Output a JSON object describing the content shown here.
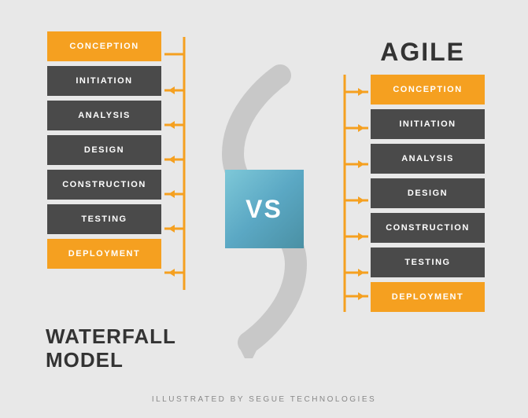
{
  "waterfall": {
    "title": "WATERFALL\nMODEL",
    "steps": [
      {
        "label": "CONCEPTION",
        "type": "orange"
      },
      {
        "label": "INITIATION",
        "type": "dark"
      },
      {
        "label": "ANALYSIS",
        "type": "dark"
      },
      {
        "label": "DESIGN",
        "type": "dark"
      },
      {
        "label": "CONSTRUCTION",
        "type": "dark"
      },
      {
        "label": "TESTING",
        "type": "dark"
      },
      {
        "label": "DEPLOYMENT",
        "type": "orange"
      }
    ]
  },
  "agile": {
    "title": "AGILE",
    "steps": [
      {
        "label": "CONCEPTION",
        "type": "orange"
      },
      {
        "label": "INITIATION",
        "type": "dark"
      },
      {
        "label": "ANALYSIS",
        "type": "dark"
      },
      {
        "label": "DESIGN",
        "type": "dark"
      },
      {
        "label": "CONSTRUCTION",
        "type": "dark"
      },
      {
        "label": "TESTING",
        "type": "dark"
      },
      {
        "label": "DEPLOYMENT",
        "type": "orange"
      }
    ]
  },
  "vs": "VS",
  "footer": "ILLUSTRATED BY SEGUE TECHNOLOGIES",
  "colors": {
    "orange": "#f5a020",
    "dark": "#4a4a4a",
    "background": "#e8e8e8",
    "vs_bg_start": "#7ec8d8",
    "vs_bg_end": "#4a90a4"
  }
}
